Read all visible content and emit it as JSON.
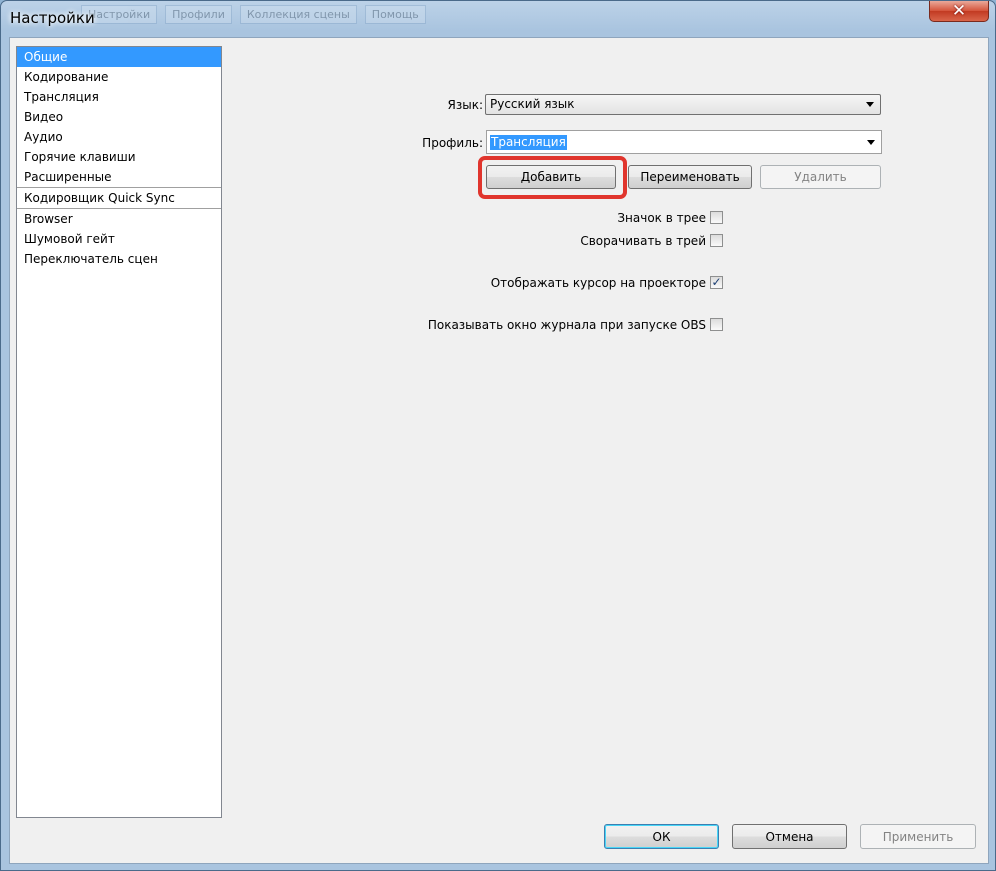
{
  "window": {
    "title": "Настройки"
  },
  "background_tabs": [
    "Настройки",
    "Профили",
    "Коллекция сцены",
    "Помощь"
  ],
  "sidebar": {
    "items": [
      {
        "label": "Общие",
        "selected": true
      },
      {
        "label": "Кодирование"
      },
      {
        "label": "Трансляция"
      },
      {
        "label": "Видео"
      },
      {
        "label": "Аудио"
      },
      {
        "label": "Горячие клавиши"
      },
      {
        "label": "Расширенные"
      },
      {
        "label": "Кодировщик Quick Sync"
      },
      {
        "label": "Browser"
      },
      {
        "label": "Шумовой гейт"
      },
      {
        "label": "Переключатель сцен"
      }
    ]
  },
  "general": {
    "language_label": "Язык:",
    "language_value": "Русский язык",
    "profile_label": "Профиль:",
    "profile_value": "Трансляция",
    "add_button": "Добавить",
    "rename_button": "Переименовать",
    "delete_button": "Удалить",
    "tray_icon_label": "Значок в трее",
    "tray_icon_checked": false,
    "minimize_tray_label": "Сворачивать в трей",
    "minimize_tray_checked": false,
    "projector_cursor_label": "Отображать курсор на проекторе",
    "projector_cursor_checked": true,
    "show_log_label": "Показывать окно журнала при запуске OBS",
    "show_log_checked": false
  },
  "footer": {
    "ok_button": "ОК",
    "cancel_button": "Отмена",
    "apply_button": "Применить"
  },
  "colors": {
    "selection": "#3399ff",
    "highlight": "#e0352d",
    "close_button": "#c23a22"
  },
  "icons": {
    "close": "close-icon",
    "dropdown": "chevron-down-icon",
    "check": "checkmark-icon"
  }
}
